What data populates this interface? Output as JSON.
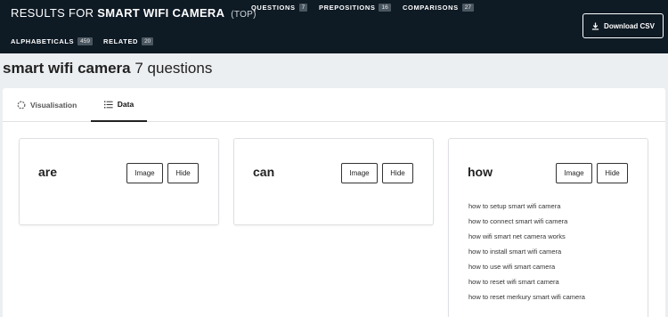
{
  "header": {
    "results_prefix": "RESULTS FOR",
    "keyword": "SMART WIFI CAMERA",
    "mode": "(TOP)",
    "nav": [
      {
        "label": "QUESTIONS",
        "count": "7"
      },
      {
        "label": "PREPOSITIONS",
        "count": "16"
      },
      {
        "label": "COMPARISONS",
        "count": "27"
      },
      {
        "label": "ALPHABETICALS",
        "count": "459"
      },
      {
        "label": "RELATED",
        "count": "20"
      }
    ],
    "download_label": "Download CSV"
  },
  "heading": {
    "keyword": "smart wifi camera",
    "suffix": " 7 questions"
  },
  "tabs": [
    {
      "label": "Visualisation",
      "icon": "circle-spinner-icon",
      "active": false
    },
    {
      "label": "Data",
      "icon": "list-icon",
      "active": true
    }
  ],
  "cards": [
    {
      "title": "are",
      "image_label": "Image",
      "hide_label": "Hide",
      "questions": []
    },
    {
      "title": "can",
      "image_label": "Image",
      "hide_label": "Hide",
      "questions": []
    },
    {
      "title": "how",
      "image_label": "Image",
      "hide_label": "Hide",
      "questions": [
        "how to setup smart wifi camera",
        "how to connect smart wifi camera",
        "how wifi smart net camera works",
        "how to install smart wifi camera",
        "how to use wifi smart camera",
        "how to reset wifi smart camera",
        "how to reset merkury smart wifi camera"
      ]
    }
  ],
  "colors": {
    "header_bg": "#0e1a24",
    "page_bg": "#eceff1",
    "badge_bg": "#4a5660"
  }
}
